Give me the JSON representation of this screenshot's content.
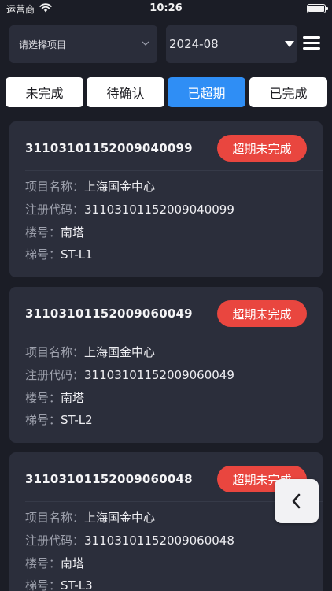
{
  "status_bar": {
    "carrier": "运营商",
    "time": "10:26"
  },
  "filters": {
    "project_select": {
      "value": "请选择项目"
    },
    "month_select": {
      "value": "2024-08"
    }
  },
  "tabs": [
    {
      "label": "未完成"
    },
    {
      "label": "待确认"
    },
    {
      "label": "已超期",
      "active": true
    },
    {
      "label": "已完成"
    }
  ],
  "labels": {
    "project_name": "项目名称：",
    "registration_code": "注册代码：",
    "building": "楼号：",
    "elevator": "梯号："
  },
  "cards": [
    {
      "code": "31103101152009040099",
      "status": "超期未完成",
      "project_name": "上海国金中心",
      "registration_code": "31103101152009040099",
      "building": "南塔",
      "elevator": "ST-L1"
    },
    {
      "code": "31103101152009060049",
      "status": "超期未完成",
      "project_name": "上海国金中心",
      "registration_code": "31103101152009060049",
      "building": "南塔",
      "elevator": "ST-L2"
    },
    {
      "code": "31103101152009060048",
      "status": "超期未完成",
      "project_name": "上海国金中心",
      "registration_code": "31103101152009060048",
      "building": "南塔",
      "elevator": "ST-L3"
    }
  ],
  "colors": {
    "background": "#1b1d26",
    "card": "#2b2e3b",
    "active_tab": "#2f8ef5",
    "overdue_badge": "#e9463f"
  },
  "icons": {
    "wifi": "wifi-icon",
    "battery": "battery-icon",
    "project_chevron": "chevron-down-icon",
    "month_caret": "caret-down-icon",
    "menu": "hamburger-menu-icon",
    "back": "chevron-left-icon"
  }
}
